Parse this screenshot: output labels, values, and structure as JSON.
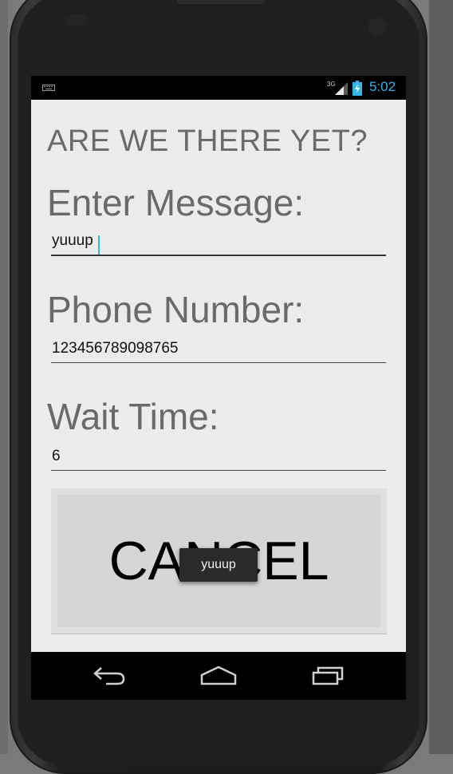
{
  "status_bar": {
    "network": "3G",
    "time": "5:02",
    "icons": [
      "keyboard-icon",
      "signal-icon",
      "battery-icon"
    ]
  },
  "app": {
    "title": "ARE WE THERE YET?"
  },
  "form": {
    "message_label": "Enter Message:",
    "message_value": "yuuup",
    "phone_label": "Phone Number:",
    "phone_value": "123456789098765",
    "wait_label": "Wait Time:",
    "wait_value": "6"
  },
  "cancel_button": {
    "label": "CANCEL"
  },
  "toast": {
    "text": "yuuup"
  },
  "nav": {
    "icons": [
      "back-icon",
      "home-icon",
      "recent-apps-icon"
    ]
  },
  "colors": {
    "accent": "#33b5e5",
    "screen_bg": "#ececec",
    "label_text": "#6a6a6a"
  }
}
